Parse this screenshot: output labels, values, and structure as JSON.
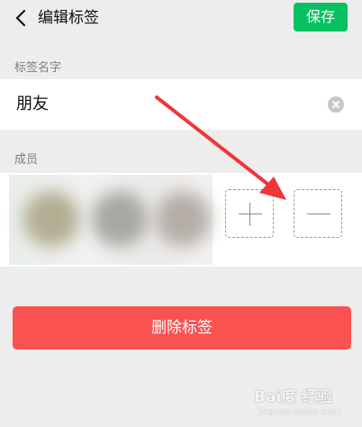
{
  "header": {
    "title": "编辑标签",
    "save_label": "保存"
  },
  "tag_name": {
    "section_label": "标签名字",
    "value": "朋友"
  },
  "members": {
    "section_label": "成员"
  },
  "delete_label": "删除标签",
  "watermark": {
    "brand": "Bai度 经验",
    "url": "jingyan.baidu.com"
  },
  "colors": {
    "primary_green": "#07c160",
    "danger_red": "#fa5151",
    "arrow_red": "#f2353b"
  }
}
